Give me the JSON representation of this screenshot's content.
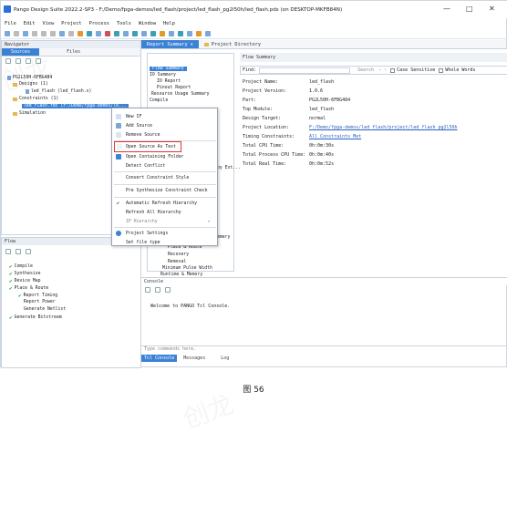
{
  "window": {
    "title": "Pango Design Suite 2022.2-SP3 - F:/Demo/fpga-demos/led_flash/project/led_flash_pg2l50h/led_flash.pds (on DESKTOP-MKFB84N)",
    "minimize": "—",
    "maximize": "□",
    "close": "✕"
  },
  "menu": [
    "File",
    "Edit",
    "View",
    "Project",
    "Process",
    "Tools",
    "Window",
    "Help"
  ],
  "navigator": {
    "title": "Navigator",
    "tabs": [
      "Sources",
      "Files"
    ],
    "tree": [
      {
        "label": "PG2L50H-6FBG484"
      },
      {
        "label": "Designs (1)"
      },
      {
        "label": "led_flash (led_flash.v)"
      },
      {
        "label": "Constraints (1)"
      },
      {
        "label": "led_flash.fdc (F:/Demo/fpga-demos/le..."
      },
      {
        "label": "Simulation"
      }
    ]
  },
  "context_menu": [
    {
      "label": "New IF"
    },
    {
      "label": "Add Source"
    },
    {
      "label": "Remove Source"
    },
    {
      "label": "Open Source As Text"
    },
    {
      "label": "Open Containing Folder"
    },
    {
      "label": "Detect Conflict"
    },
    {
      "label": "Convert Constraint Style"
    },
    {
      "label": "Pre Synthesize Constraint Check"
    },
    {
      "label": "Automatic Refresh Hierarchy"
    },
    {
      "label": "Refresh All Hierarchy"
    },
    {
      "label": "IP Hierarchy"
    },
    {
      "label": "Project Settings"
    },
    {
      "label": "Set file type"
    }
  ],
  "ip_arrow": "▸",
  "check_mark": "✔",
  "flow": {
    "title": "Flow",
    "items": [
      {
        "label": "Compile"
      },
      {
        "label": "Synthesize"
      },
      {
        "label": "Device Map"
      },
      {
        "label": "Place & Route"
      },
      {
        "label": "Report Timing"
      },
      {
        "label": "Report Power"
      },
      {
        "label": "Generate Netlist"
      },
      {
        "label": "Generate Bitstream"
      }
    ]
  },
  "report_tabs": [
    "Report Summary",
    "Project Directory"
  ],
  "summary_tree": [
    "Flow Summary",
    "IO Summary",
    "IO Report",
    "Pinout Report",
    "Resource Usage Summary",
    "Compile",
    "Timing",
    "Place & Route",
    "Recovery",
    "Removal",
    "Minimum Pulse Width",
    "Runtime & Memory"
  ],
  "summary_tree_partial": {
    "a": "by Ext...",
    "b": "mmery"
  },
  "flow_summary": {
    "title": "Flow Summary",
    "find_label": "Find:",
    "search_label": "Search",
    "case_label": "Case Sensitive",
    "whole_label": "Whole Words",
    "rows": [
      {
        "k": "Project Name:",
        "v": "led_flash"
      },
      {
        "k": "Project Version:",
        "v": "1.0.6"
      },
      {
        "k": "Part:",
        "v": "PG2L50H-6FBG484"
      },
      {
        "k": "Top Module:",
        "v": "led_flash"
      },
      {
        "k": "Design Target:",
        "v": "normal"
      },
      {
        "k": "Project Location:",
        "v": "F:/Demo/fpga-demos/led_flash/project/led_flash_pg2l50h"
      },
      {
        "k": "Timing Constraints:",
        "v": "All Constraints Met"
      },
      {
        "k": "Total CPU Time:",
        "v": "0h:0m:30s"
      },
      {
        "k": "Total Process CPU Time:",
        "v": "0h:0m:40s"
      },
      {
        "k": "Total Real Time:",
        "v": "0h:0m:52s"
      }
    ]
  },
  "console": {
    "title": "Console",
    "welcome": "Welcome to PANGO Tcl Console.",
    "input_placeholder": "Type commands here.",
    "tabs": [
      "Tcl Console",
      "Messages",
      "Log"
    ]
  },
  "caption": "图 56",
  "watermark": "创龙"
}
